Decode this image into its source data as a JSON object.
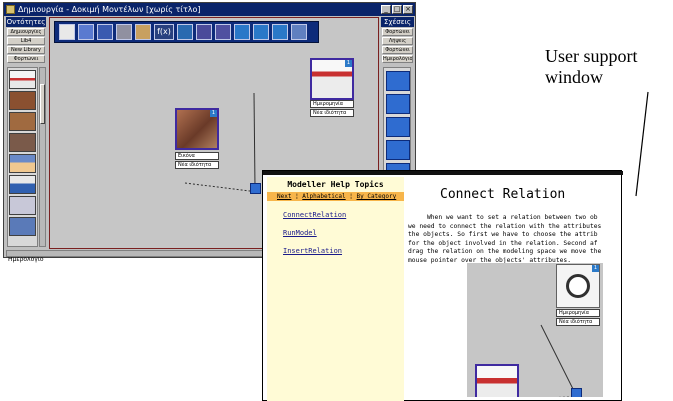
{
  "app": {
    "title": "Δημιουργία - Δοκιμή Μοντέλων [χωρίς τίτλο]",
    "window_buttons": [
      "_",
      "□",
      "×"
    ],
    "left_panel": {
      "header": "Οντότητες",
      "buttons": [
        "Δημιουργίες",
        "Lib4",
        "New Library",
        "Φορτώνει"
      ],
      "status": "Ημερολόγιο"
    },
    "right_panel": {
      "header": "Σχέσεις",
      "buttons": [
        "Φορτώνει",
        "Λήψεις",
        "Φορτώνει",
        "Ημερολόγιο"
      ]
    },
    "toolbar": {
      "fx_label": "f(x)",
      "icons": [
        "new-doc-icon",
        "open-icon",
        "save-icon",
        "save-as-icon",
        "brush-icon",
        "fx-icon",
        "chart-icon",
        "table-icon",
        "grid-icon",
        "play-icon",
        "stop-icon",
        "step-icon",
        "undo-icon"
      ]
    },
    "canvas": {
      "objects": [
        {
          "name": "calendar-object",
          "badge": "1",
          "attrs": [
            "Ημερομηνία",
            "Νέα ιδιότητα"
          ]
        },
        {
          "name": "photo-object",
          "badge": "1",
          "attrs": [
            "Εικόνα",
            "Νέα ιδιότητα"
          ]
        }
      ]
    }
  },
  "help": {
    "toc_title": "Modeller Help Topics",
    "tabs": [
      "Next",
      "Alphabetical",
      "By Category"
    ],
    "topics": [
      "ConnectRelation",
      "RunModel",
      "InsertRelation"
    ],
    "heading": "Connect Relation",
    "body": "     When we want to set a relation between two ob\nwe need to connect the relation with the attributes\nthe objects. So first we have to choose the attrib\nfor the object involved in the relation. Second af\ndrag the relation on the modeling space we move the\nmouse pointer over the objects' attributes.",
    "screenshot_attrs": [
      "Ημερομηνία",
      "Νέα ιδιότητα"
    ],
    "screenshot_badge": "1"
  },
  "caption": {
    "line1": "User support",
    "line2": "window"
  }
}
